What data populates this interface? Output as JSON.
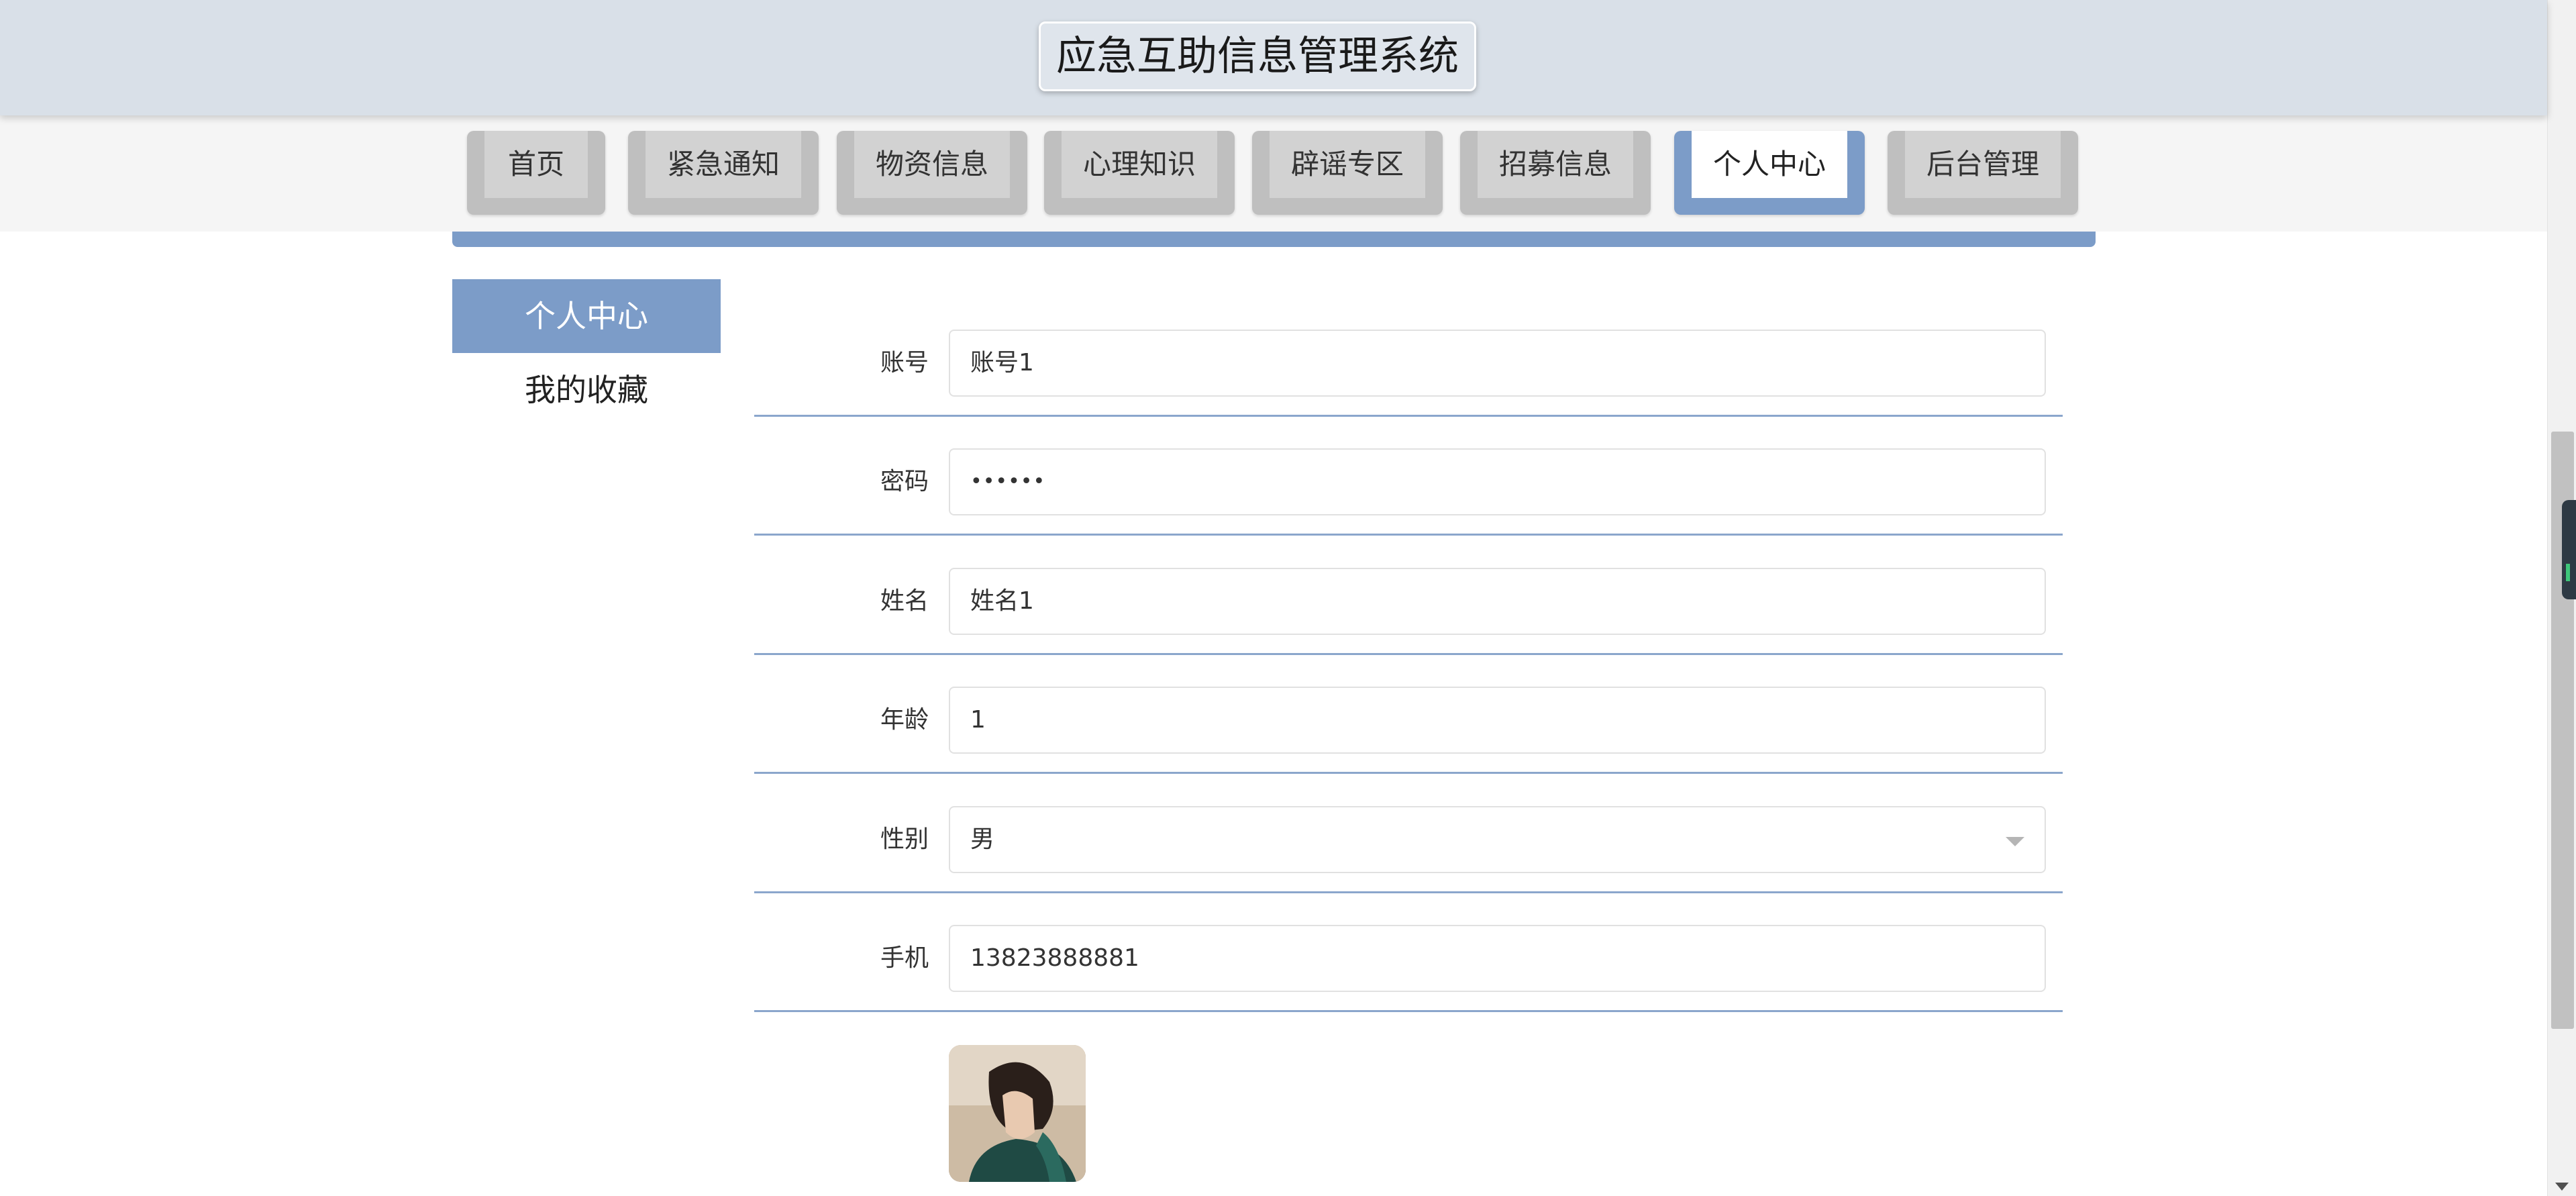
{
  "header": {
    "title": "应急互助信息管理系统"
  },
  "nav": {
    "items": [
      {
        "label": "首页"
      },
      {
        "label": "紧急通知"
      },
      {
        "label": "物资信息"
      },
      {
        "label": "心理知识"
      },
      {
        "label": "辟谣专区"
      },
      {
        "label": "招募信息"
      },
      {
        "label": "个人中心"
      },
      {
        "label": "后台管理"
      }
    ],
    "active_label": "个人中心"
  },
  "sidebar": {
    "items": [
      {
        "label": "个人中心"
      },
      {
        "label": "我的收藏"
      }
    ]
  },
  "form": {
    "account": {
      "label": "账号",
      "value": "账号1"
    },
    "password": {
      "label": "密码",
      "value": "••••••"
    },
    "name": {
      "label": "姓名",
      "value": "姓名1"
    },
    "age": {
      "label": "年龄",
      "value": "1"
    },
    "gender": {
      "label": "性别",
      "value": "男"
    },
    "phone": {
      "label": "手机",
      "value": "13823888881"
    }
  },
  "colors": {
    "accent": "#7c9cc8",
    "header_bg": "#d9e0e8",
    "nav_tab": "#bfbfbf"
  }
}
